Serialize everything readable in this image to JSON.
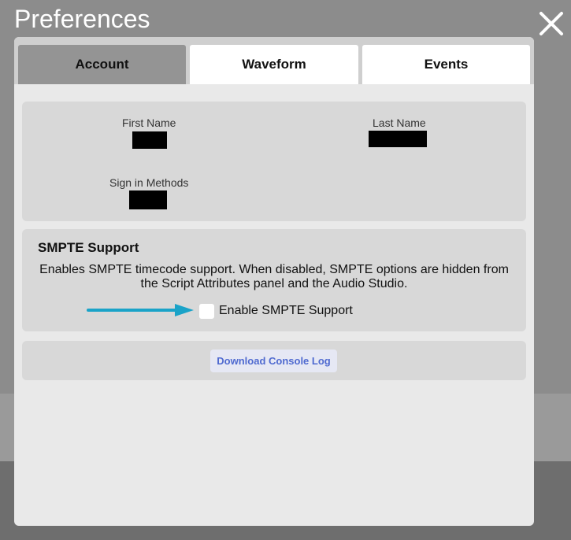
{
  "modal": {
    "title": "Preferences"
  },
  "tabs": [
    {
      "label": "Account",
      "active": true
    },
    {
      "label": "Waveform",
      "active": false
    },
    {
      "label": "Events",
      "active": false
    }
  ],
  "account": {
    "first_name_label": "First Name",
    "last_name_label": "Last Name",
    "sign_in_methods_label": "Sign in Methods"
  },
  "smpte": {
    "title": "SMPTE Support",
    "description": "Enables SMPTE timecode support. When disabled, SMPTE options are hidden from the Script Attributes panel and the Audio Studio.",
    "checkbox_label": "Enable SMPTE Support",
    "checked": false
  },
  "actions": {
    "download_label": "Download Console Log"
  },
  "icons": {
    "close": "close-icon",
    "arrow": "arrow-right-icon"
  },
  "colors": {
    "accent_arrow": "#1aa3c8",
    "button_text": "#4f6ad0",
    "active_tab": "#949494"
  }
}
